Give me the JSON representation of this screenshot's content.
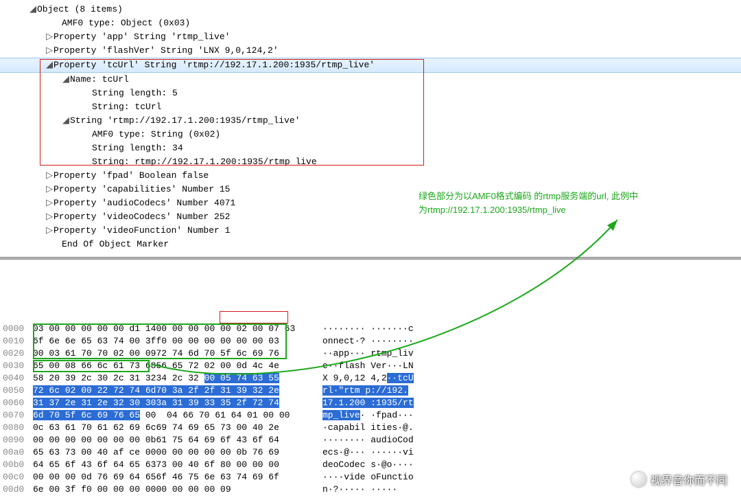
{
  "tree": {
    "root": "Object (8 items)",
    "children": [
      "AMF0 type: Object (0x03)",
      "Property 'app' String 'rtmp_live'",
      "Property 'flashVer' String 'LNX 9,0,124,2'"
    ],
    "selected": "Property 'tcUrl' String 'rtmp://192.17.1.200:1935/rtmp_live'",
    "sel_children": {
      "name_header": "Name: tcUrl",
      "name_len": "String length: 5",
      "name_str": "String: tcUrl",
      "val_header": "String 'rtmp://192.17.1.200:1935/rtmp_live'",
      "val_type": "AMF0 type: String (0x02)",
      "val_len": "String length: 34",
      "val_str": "String: rtmp://192.17.1.200:1935/rtmp_live"
    },
    "after": [
      "Property 'fpad' Boolean false",
      "Property 'capabilities' Number 15",
      "Property 'audioCodecs' Number 4071",
      "Property 'videoCodecs' Number 252",
      "Property 'videoFunction' Number 1",
      "End Of Object Marker"
    ]
  },
  "hex": {
    "rows": [
      {
        "o": "0000",
        "l": "03 00 00 00 00 00 d1 14",
        "r": "00 00 00 00 00 02 00 07 63",
        "a": "········ ·······c"
      },
      {
        "o": "0010",
        "l": "6f 6e 6e 65 63 74 00 3f",
        "r": "f0 00 00 00 00 00 00 03",
        "a": "onnect·? ········"
      },
      {
        "o": "0020",
        "l": "00 03 61 70 70 02 00 09",
        "r": "72 74 6d 70 5f 6c 69 76",
        "a": "··app··· rtmp_liv"
      },
      {
        "o": "0030",
        "l": "65 00 08 66 6c 61 73 68",
        "r": "56 65 72 02 00 0d 4c 4e",
        "a": "e··flash Ver···LN"
      },
      {
        "o": "0040",
        "l": "58 20 39 2c 30 2c 31 32",
        "r": "34 2c 32 ",
        "rh": "00 05 74 63 55",
        "a": "X 9,0,12 4,2",
        "ah": "··tcU"
      },
      {
        "o": "0050",
        "lh": "72 6c 02 00 22 72 74 6d",
        "rh": "70 3a 2f 2f 31 39 32 2e",
        "ah": "rl·\"rtm p://192."
      },
      {
        "o": "0060",
        "lh": "31 37 2e 31 2e 32 30 30",
        "rh": "3a 31 39 33 35 2f 72 74",
        "ah": "17.1.200 :1935/rt"
      },
      {
        "o": "0070",
        "lh": "6d 70 5f 6c 69 76 65",
        "r": " 00  04 66 70 61 64 01 00 00",
        "ahp": "mp_live",
        "a": "· ·fpad···"
      },
      {
        "o": "0080",
        "l": "0c 63 61 70 61 62 69 6c",
        "r": "69 74 69 65 73 00 40 2e",
        "a": "·capabil ities·@."
      },
      {
        "o": "0090",
        "l": "00 00 00 00 00 00 00 0b",
        "r": "61 75 64 69 6f 43 6f 64",
        "a": "········ audioCod"
      },
      {
        "o": "00a0",
        "l": "65 63 73 00 40 af ce 00",
        "r": "00 00 00 00 00 0b 76 69",
        "a": "ecs·@··· ······vi"
      },
      {
        "o": "00b0",
        "l": "64 65 6f 43 6f 64 65 63",
        "r": "73 00 40 6f 80 00 00 00",
        "a": "deoCodec s·@o····"
      },
      {
        "o": "00c0",
        "l": "00 00 00 0d 76 69 64 65",
        "r": "6f 46 75 6e 63 74 69 6f",
        "a": "····vide oFunctio"
      },
      {
        "o": "00d0",
        "l": "6e 00 3f f0 00 00 00 00",
        "r": "00 00 00 00 09",
        "a": "n·?····· ·····"
      }
    ]
  },
  "annotation": {
    "line1": "绿色部分为以AMF0格式编码 的rtmp服务端的url, 此例中",
    "line2": "为rtmp://192.17.1.200:1935/rtmp_live"
  },
  "watermark": "视界音你而不同",
  "icons": {
    "open": "◢",
    "closed": "▷"
  }
}
